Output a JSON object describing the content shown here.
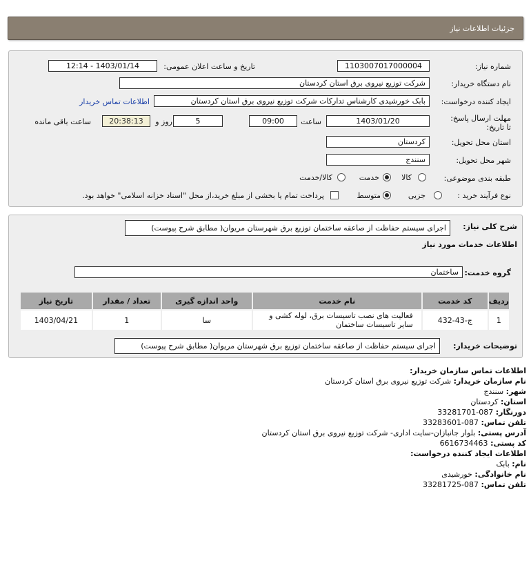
{
  "header": {
    "title": "جزئیات اطلاعات نیاز"
  },
  "form": {
    "need_number_label": "شماره نیاز:",
    "need_number": "1103007017000004",
    "announce_label": "تاریخ و ساعت اعلان عمومی:",
    "announce_value": "1403/01/14 - 12:14",
    "buyer_org_label": "نام دستگاه خریدار:",
    "buyer_org": "شرکت توزیع نیروی برق استان کردستان",
    "creator_label": "ایجاد کننده درخواست:",
    "creator": "بابک خورشیدی کارشناس تدارکات شرکت توزیع نیروی برق استان کردستان",
    "contact_link": "اطلاعات تماس خریدار",
    "deadline_label": "مهلت ارسال پاسخ: تا تاریخ:",
    "deadline_date": "1403/01/20",
    "time_label": "ساعت",
    "deadline_time": "09:00",
    "days_value": "5",
    "days_label": "روز و",
    "remaining_time": "20:38:13",
    "remaining_label": "ساعت باقی مانده",
    "province_label": "استان محل تحویل:",
    "province": "کردستان",
    "city_label": "شهر محل تحویل:",
    "city": "سنندج",
    "category_label": "طبقه بندی موضوعی:",
    "category_options": [
      "کالا",
      "خدمت",
      "کالا/خدمت"
    ],
    "category_selected": "خدمت",
    "process_label": "نوع فرآیند خرید :",
    "process_options": [
      "جزیی",
      "متوسط"
    ],
    "process_selected": "متوسط",
    "payment_note": "پرداخت تمام یا بخشی از مبلغ خرید،از محل \"اسناد خزانه اسلامی\" خواهد بود."
  },
  "description": {
    "label": "شرح کلی نیاز:",
    "value": "اجرای سیستم حفاظت از صاعقه ساختمان توزیع برق شهرستان مریوان( مطابق شرح پیوست)"
  },
  "services": {
    "section_title": "اطلاعات خدمات مورد نیاز",
    "group_label": "گروه خدمت:",
    "group_value": "ساختمان",
    "columns": [
      "ردیف",
      "کد خدمت",
      "نام خدمت",
      "واحد اندازه گیری",
      "تعداد / مقدار",
      "تاریخ نیاز"
    ],
    "rows": [
      [
        "1",
        "ج-43-432",
        "فعالیت های نصب تاسیسات برق، لوله کشی و سایر تاسیسات ساختمان",
        "سا",
        "1",
        "1403/04/21"
      ]
    ],
    "notes_label": "توضیحات خریدار:",
    "notes_value": "اجرای سیستم حفاظت از صاعقه ساختمان توزیع برق شهرستان مریوان( مطابق شرح پیوست)"
  },
  "contact": {
    "title": "اطلاعات تماس سازمان خریدار:",
    "org_label": "نام سازمان خریدار:",
    "org": "شرکت توزیع نیروی برق استان کردستان",
    "city_label": "شهر:",
    "city": "سنندج",
    "province_label": "استان:",
    "province": "کردستان",
    "fax_label": "دورنگار:",
    "fax": "087-33281701",
    "phone_label": "تلفن تماس:",
    "phone": "087-33283601",
    "address_label": "آدرس پستی:",
    "address": "بلوار جانبازان-سایت اداری- شرکت توزیع نیروی برق استان کردستان",
    "postal_label": "کد پستی:",
    "postal": "6616734463",
    "creator_title": "اطلاعات ایجاد کننده درخواست:",
    "name_label": "نام:",
    "name": "بابک",
    "family_label": "نام خانوادگی:",
    "family": "خورشیدی",
    "creator_phone_label": "تلفن تماس:",
    "creator_phone": "087-33281725"
  }
}
